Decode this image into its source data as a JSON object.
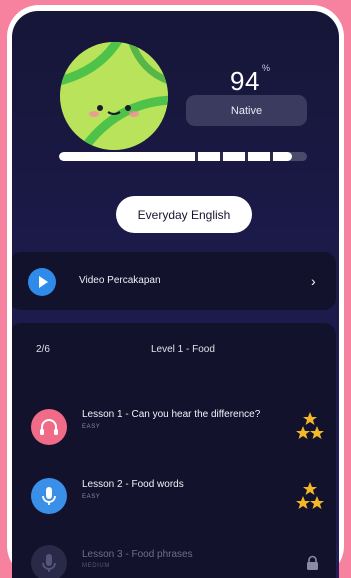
{
  "profile": {
    "percent": "94",
    "percent_symbol": "%",
    "level_label": "Native",
    "progress": 0.94
  },
  "topic": {
    "label": "Everyday English"
  },
  "video": {
    "label": "Video Percakapan"
  },
  "level": {
    "count": "2/6",
    "title": "Level 1 - Food",
    "lessons": [
      {
        "title": "Lesson 1 - Can you hear the difference?",
        "difficulty": "EASY",
        "icon": "headphones-icon",
        "status": "completed",
        "color": "#f06b87"
      },
      {
        "title": "Lesson 2 - Food words",
        "difficulty": "EASY",
        "icon": "microphone-icon",
        "status": "completed",
        "color": "#3a8fe8"
      },
      {
        "title": "Lesson 3 - Food phrases",
        "difficulty": "MEDIUM",
        "icon": "microphone-icon",
        "status": "locked",
        "color": "#2a2a48"
      }
    ]
  },
  "colors": {
    "background": "#f7829f",
    "card": "#12122c",
    "accent": "#2e8bea",
    "star": "#f4b728"
  }
}
